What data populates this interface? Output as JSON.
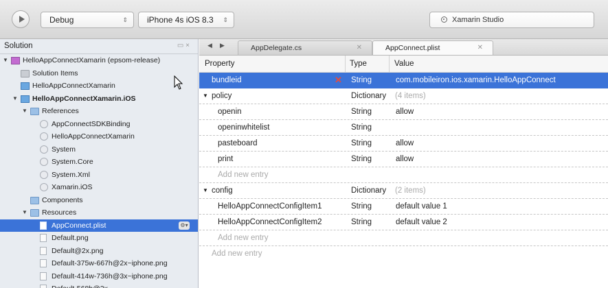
{
  "toolbar": {
    "configuration": "Debug",
    "device": "iPhone 4s iOS 8.3",
    "status_app": "Xamarin Studio"
  },
  "sidebar": {
    "title": "Solution",
    "tree": [
      {
        "label": "HelloAppConnectXamarin (epsom-release)",
        "indent": 0,
        "disclosure": "▼",
        "icon": "sln",
        "icon_name": "solution-icon",
        "bold": false
      },
      {
        "label": "Solution Items",
        "indent": 1,
        "disclosure": "",
        "icon": "folder-gray",
        "icon_name": "folder-icon",
        "bold": false
      },
      {
        "label": "HelloAppConnectXamarin",
        "indent": 1,
        "disclosure": "",
        "icon": "proj",
        "icon_name": "project-icon",
        "bold": false
      },
      {
        "label": "HelloAppConnectXamarin.iOS",
        "indent": 1,
        "disclosure": "▼",
        "icon": "proj",
        "icon_name": "project-icon",
        "bold": true
      },
      {
        "label": "References",
        "indent": 2,
        "disclosure": "▼",
        "icon": "folder",
        "icon_name": "references-folder-icon",
        "bold": false
      },
      {
        "label": "AppConnectSDKBinding",
        "indent": 3,
        "disclosure": "",
        "icon": "ref",
        "icon_name": "reference-icon",
        "bold": false
      },
      {
        "label": "HelloAppConnectXamarin",
        "indent": 3,
        "disclosure": "",
        "icon": "ref",
        "icon_name": "reference-icon",
        "bold": false
      },
      {
        "label": "System",
        "indent": 3,
        "disclosure": "",
        "icon": "ref",
        "icon_name": "reference-icon",
        "bold": false
      },
      {
        "label": "System.Core",
        "indent": 3,
        "disclosure": "",
        "icon": "ref",
        "icon_name": "reference-icon",
        "bold": false
      },
      {
        "label": "System.Xml",
        "indent": 3,
        "disclosure": "",
        "icon": "ref",
        "icon_name": "reference-icon",
        "bold": false
      },
      {
        "label": "Xamarin.iOS",
        "indent": 3,
        "disclosure": "",
        "icon": "ref",
        "icon_name": "reference-icon",
        "bold": false
      },
      {
        "label": "Components",
        "indent": 2,
        "disclosure": "",
        "icon": "folder",
        "icon_name": "folder-icon",
        "bold": false
      },
      {
        "label": "Resources",
        "indent": 2,
        "disclosure": "▼",
        "icon": "folder",
        "icon_name": "folder-icon",
        "bold": false
      },
      {
        "label": "AppConnect.plist",
        "indent": 3,
        "disclosure": "",
        "icon": "file-sel",
        "icon_name": "file-icon",
        "bold": false,
        "selected": true
      },
      {
        "label": "Default.png",
        "indent": 3,
        "disclosure": "",
        "icon": "file",
        "icon_name": "file-icon",
        "bold": false
      },
      {
        "label": "Default@2x.png",
        "indent": 3,
        "disclosure": "",
        "icon": "file",
        "icon_name": "file-icon",
        "bold": false
      },
      {
        "label": "Default-375w-667h@2x~iphone.png",
        "indent": 3,
        "disclosure": "",
        "icon": "file",
        "icon_name": "file-icon",
        "bold": false
      },
      {
        "label": "Default-414w-736h@3x~iphone.png",
        "indent": 3,
        "disclosure": "",
        "icon": "file",
        "icon_name": "file-icon",
        "bold": false
      },
      {
        "label": "Default-568h@2x...",
        "indent": 3,
        "disclosure": "",
        "icon": "file",
        "icon_name": "file-icon",
        "bold": false
      }
    ]
  },
  "tabs": [
    {
      "label": "AppDelegate.cs",
      "active": false
    },
    {
      "label": "AppConnect.plist",
      "active": true
    }
  ],
  "grid": {
    "headers": {
      "property": "Property",
      "type": "Type",
      "value": "Value"
    },
    "rows": [
      {
        "property": "bundleid",
        "type": "String",
        "value": "com.mobileiron.ios.xamarin.HelloAppConnect",
        "depth": 0,
        "selected": true,
        "delete": true
      },
      {
        "property": "policy",
        "type": "Dictionary",
        "value": "(4 items)",
        "depth": 0,
        "expand": "▼",
        "count": true
      },
      {
        "property": "openin",
        "type": "String",
        "value": "allow",
        "depth": 1
      },
      {
        "property": "openinwhitelist",
        "type": "String",
        "value": "",
        "depth": 1
      },
      {
        "property": "pasteboard",
        "type": "String",
        "value": "allow",
        "depth": 1
      },
      {
        "property": "print",
        "type": "String",
        "value": "allow",
        "depth": 1
      },
      {
        "property": "Add new entry",
        "type": "",
        "value": "",
        "depth": 1,
        "muted": true
      },
      {
        "property": "config",
        "type": "Dictionary",
        "value": "(2 items)",
        "depth": 0,
        "expand": "▼",
        "count": true
      },
      {
        "property": "HelloAppConnectConfigItem1",
        "type": "String",
        "value": "default value 1",
        "depth": 1
      },
      {
        "property": "HelloAppConnectConfigItem2",
        "type": "String",
        "value": "default value 2",
        "depth": 1
      },
      {
        "property": "Add new entry",
        "type": "",
        "value": "",
        "depth": 1,
        "muted": true
      },
      {
        "property": "Add new entry",
        "type": "",
        "value": "",
        "depth": 0,
        "muted": true,
        "noborder": true
      }
    ]
  },
  "colors": {
    "selection": "#3b73d8",
    "delete": "#e84b3c"
  }
}
